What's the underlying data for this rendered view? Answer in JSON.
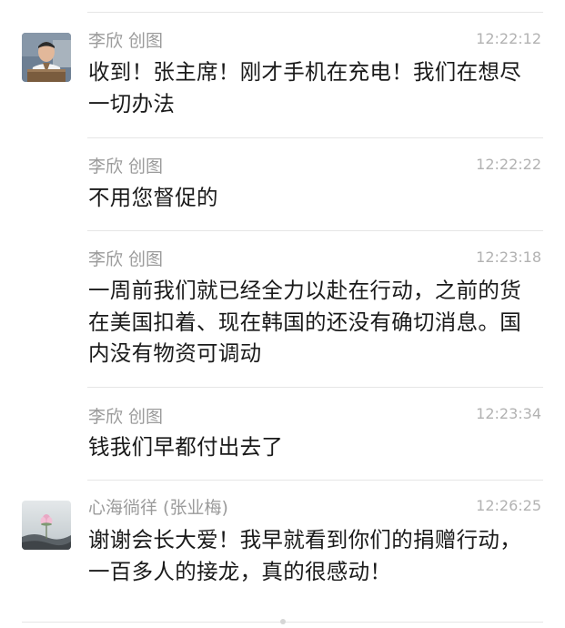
{
  "messages": [
    {
      "sender": "李欣 创图",
      "time": "12:22:12",
      "lines": [
        "收到！张主席！刚才手机在充电！我们在想尽",
        "一切办法"
      ],
      "avatar": "person-photo-icon"
    },
    {
      "sender": "李欣 创图",
      "time": "12:22:22",
      "lines": [
        "不用您督促的"
      ]
    },
    {
      "sender": "李欣 创图",
      "time": "12:23:18",
      "lines": [
        "一周前我们就已经全力以赴在行动，之前的货",
        "在美国扣着、现在韩国的还没有确切消息。国",
        "内没有物资可调动"
      ]
    },
    {
      "sender": "李欣 创图",
      "time": "12:23:34",
      "lines": [
        "钱我们早都付出去了"
      ]
    },
    {
      "sender": "心海徜徉 (张业梅)",
      "time": "12:26:25",
      "lines": [
        "谢谢会长大爱！我早就看到你们的捐赠行动，",
        "一百多人的接龙，真的很感动！"
      ],
      "avatar": "lotus-photo-icon"
    }
  ],
  "colors": {
    "text": "#1a1a1a",
    "sender": "#9b9b9b",
    "time": "#b2b2b2",
    "divider": "#e6e6e6",
    "background": "#ffffff"
  }
}
